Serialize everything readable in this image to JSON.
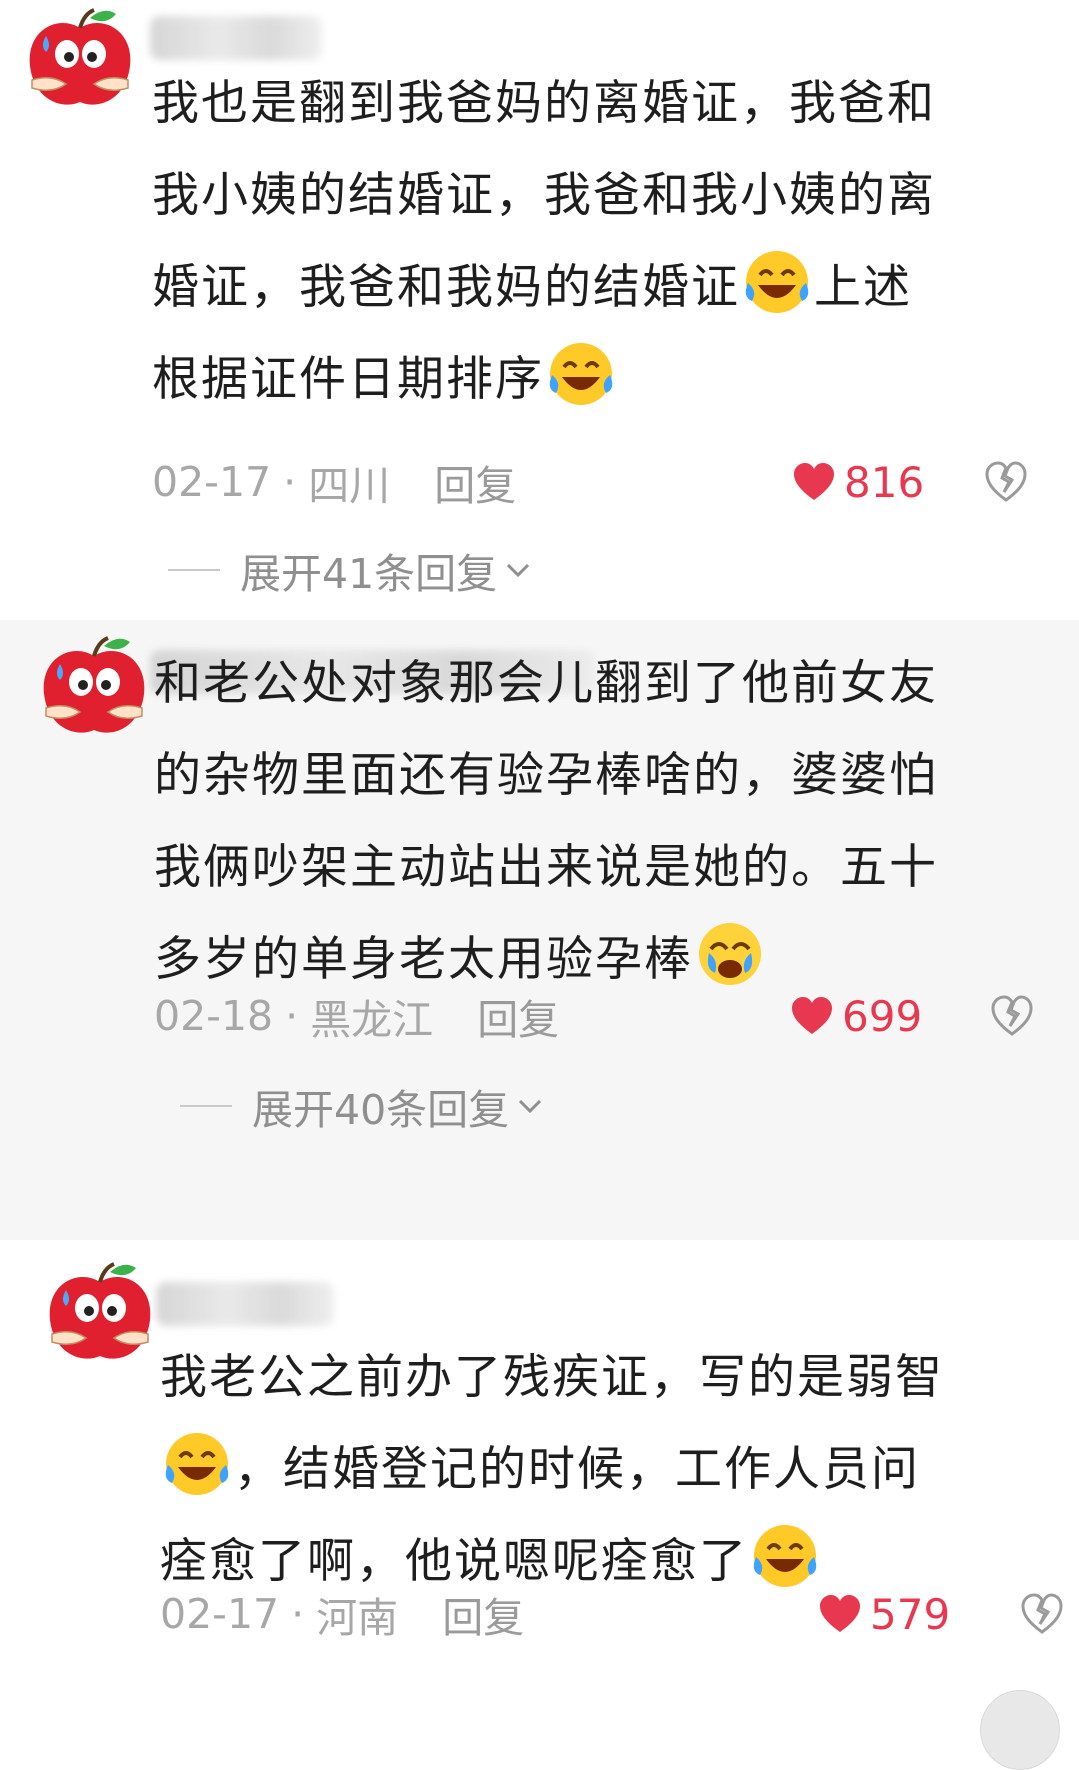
{
  "colors": {
    "like_red": "#e8384f",
    "meta_gray": "#a7a7a7",
    "alt_bg": "#f6f6f6"
  },
  "comments": [
    {
      "avatar_icon": "apple-sticker-icon",
      "lines": [
        "我也是翻到我爸妈的离婚证，我爸和",
        "我小姨的结婚证，我爸和我小姨的离",
        "婚证，我爸和我妈的结婚证",
        "根据证件日期排序"
      ],
      "line3_tail": "上述",
      "date": "02-17",
      "location": "四川",
      "reply_label": "回复",
      "likes": "816",
      "expand_label": "展开41条回复"
    },
    {
      "avatar_icon": "apple-sticker-icon",
      "lines": [
        "和老公处对象那会儿翻到了他前女友",
        "的杂物里面还有验孕棒啥的，婆婆怕",
        "我俩吵架主动站出来说是她的。五十",
        "多岁的单身老太用验孕棒"
      ],
      "date": "02-18",
      "location": "黑龙江",
      "reply_label": "回复",
      "likes": "699",
      "expand_label": "展开40条回复"
    },
    {
      "avatar_icon": "apple-sticker-icon",
      "lines": [
        "我老公之前办了残疾证，写的是弱智",
        "，结婚登记的时候，工作人员问",
        "痊愈了啊，他说嗯呢痊愈了"
      ],
      "date": "02-17",
      "location": "河南",
      "reply_label": "回复",
      "likes": "579"
    }
  ]
}
